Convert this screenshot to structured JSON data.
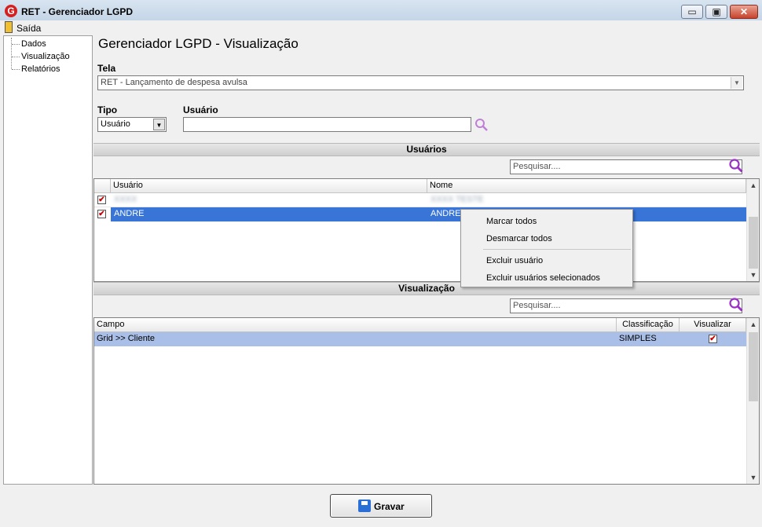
{
  "window": {
    "title": "RET - Gerenciador LGPD",
    "min_symbol": "▭",
    "max_symbol": "▣",
    "close_symbol": "✕"
  },
  "menu": {
    "exit": "Saída"
  },
  "tree": {
    "items": [
      "Dados",
      "Visualização",
      "Relatórios"
    ]
  },
  "page": {
    "title": "Gerenciador LGPD - Visualização"
  },
  "tela": {
    "label": "Tela",
    "value": "RET - Lançamento de despesa avulsa"
  },
  "tipo": {
    "label": "Tipo",
    "value": "Usuário"
  },
  "usuario": {
    "label": "Usuário",
    "value": ""
  },
  "users_section": {
    "title": "Usuários",
    "search_placeholder": "Pesquisar....",
    "columns": [
      "Usuário",
      "Nome"
    ],
    "rows": [
      {
        "checked": true,
        "usuario": "XXXX",
        "nome": "XXXX TESTE",
        "blurred": true
      },
      {
        "checked": true,
        "usuario": "ANDRE",
        "nome": "ANDRE",
        "selected": true
      }
    ]
  },
  "context_menu": {
    "items": [
      "Marcar todos",
      "Desmarcar todos",
      "Excluir usuário",
      "Excluir usuários selecionados"
    ]
  },
  "view_section": {
    "title": "Visualização",
    "search_placeholder": "Pesquisar....",
    "columns": [
      "Campo",
      "Classificação",
      "Visualizar"
    ],
    "rows": [
      {
        "campo": "Grid >> Cliente",
        "classificacao": "SIMPLES",
        "visualizar": true
      }
    ]
  },
  "save_button": {
    "label": "Gravar"
  },
  "colors": {
    "selection": "#3875d7",
    "row_highlight": "#a9bfe8",
    "search_icon": "#9b2fc7"
  }
}
